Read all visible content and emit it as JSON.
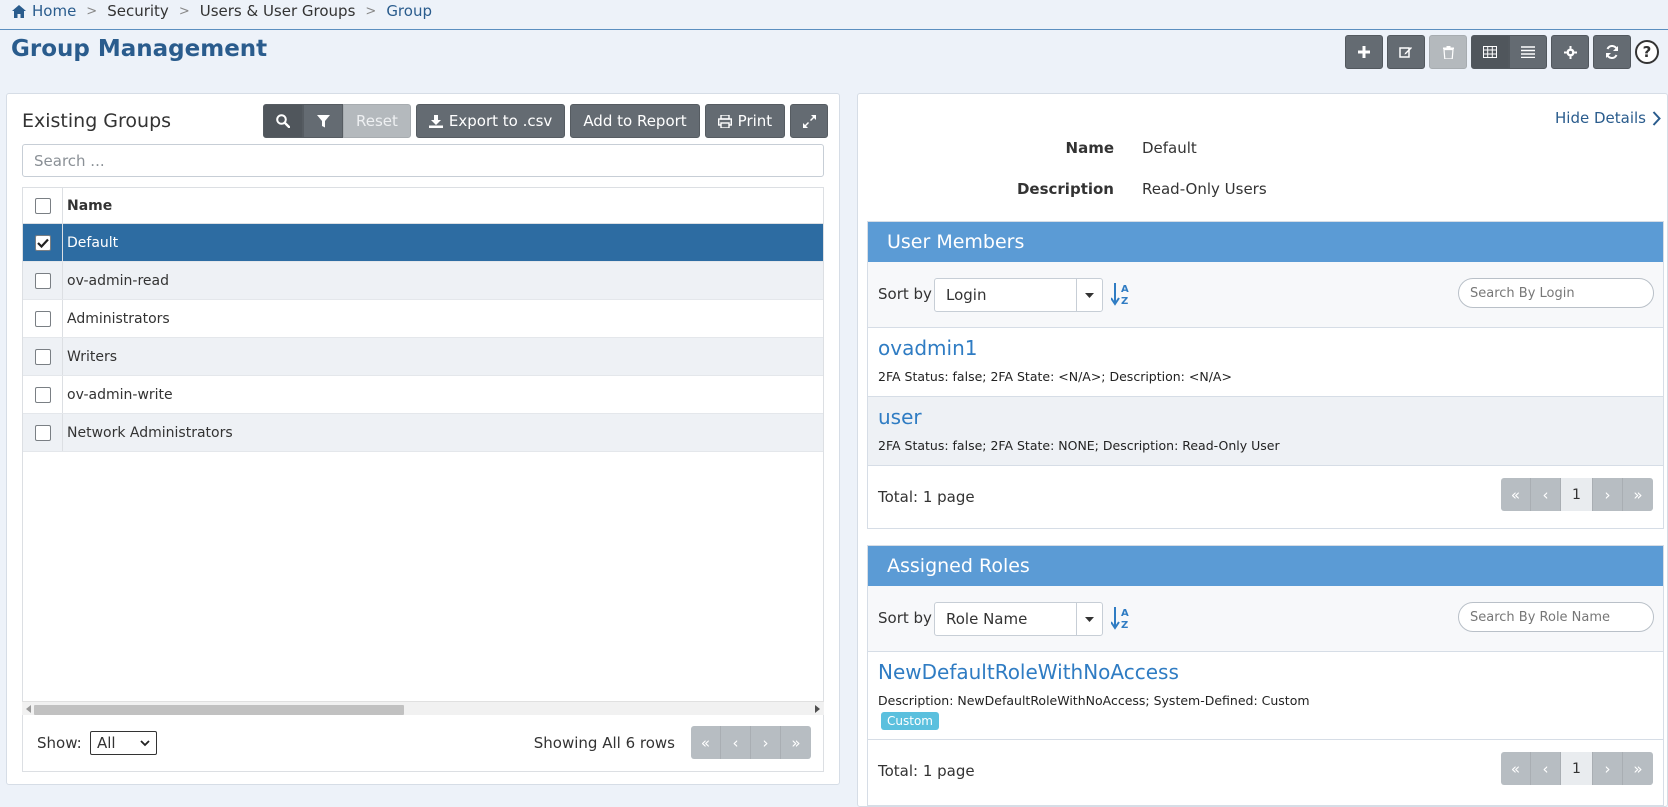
{
  "breadcrumb": {
    "items": [
      "Home",
      "Security",
      "Users & User Groups",
      "Group"
    ],
    "separator": ">"
  },
  "page": {
    "title": "Group Management"
  },
  "left": {
    "title": "Existing Groups",
    "reset_label": "Reset",
    "export_label": "Export to .csv",
    "add_report_label": "Add to Report",
    "print_label": "Print",
    "search_placeholder": "Search ...",
    "column_name": "Name",
    "rows": [
      {
        "name": "Default",
        "checked": true
      },
      {
        "name": "ov-admin-read",
        "checked": false
      },
      {
        "name": "Administrators",
        "checked": false
      },
      {
        "name": "Writers",
        "checked": false
      },
      {
        "name": "ov-admin-write",
        "checked": false
      },
      {
        "name": "Network Administrators",
        "checked": false
      }
    ],
    "show_label": "Show:",
    "show_value": "All",
    "showing_text": "Showing All 6 rows"
  },
  "right": {
    "hide_details_label": "Hide Details",
    "name_label": "Name",
    "name_value": "Default",
    "description_label": "Description",
    "description_value": "Read-Only Users",
    "user_members": {
      "title": "User Members",
      "sort_by_label": "Sort by",
      "sort_value": "Login",
      "search_placeholder": "Search By Login",
      "items": [
        {
          "title": "ovadmin1",
          "desc": "2FA Status: false; 2FA State: <N/A>; Description: <N/A>"
        },
        {
          "title": "user",
          "desc": "2FA Status: false; 2FA State: NONE; Description: Read-Only User"
        }
      ],
      "total_label": "Total: 1 page",
      "page_number": "1"
    },
    "assigned_roles": {
      "title": "Assigned Roles",
      "sort_by_label": "Sort by",
      "sort_value": "Role Name",
      "search_placeholder": "Search By Role Name",
      "items": [
        {
          "title": "NewDefaultRoleWithNoAccess",
          "desc": "Description: NewDefaultRoleWithNoAccess; System-Defined: Custom",
          "badge": "Custom"
        }
      ],
      "total_label": "Total: 1 page",
      "page_number": "1"
    }
  },
  "pager_glyphs": {
    "first": "«",
    "prev": "‹",
    "next": "›",
    "last": "»"
  },
  "help_glyph": "?",
  "colors": {
    "accent": "#2a5c8d",
    "selected_row": "#2d6ca2",
    "section_head": "#5b9bd5",
    "button": "#646b72",
    "badge": "#5bc0de"
  }
}
